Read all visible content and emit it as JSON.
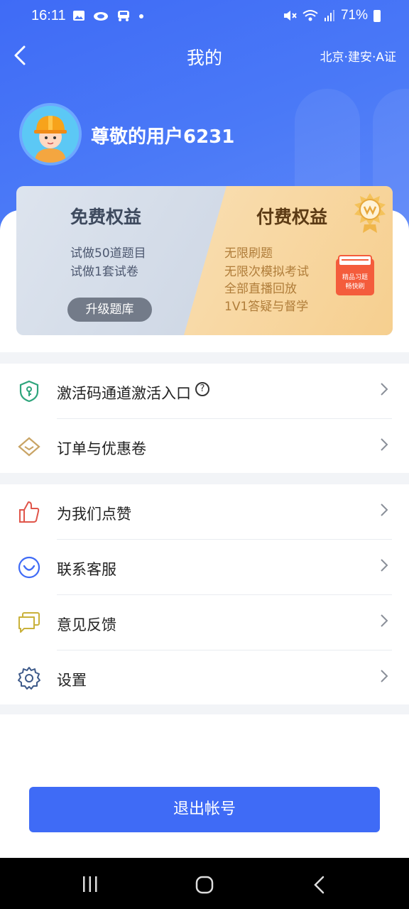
{
  "status_bar": {
    "time": "16:11",
    "left_icons": [
      "image-icon",
      "cloud-icon",
      "car-icon",
      "dot"
    ],
    "battery": "71%"
  },
  "navbar": {
    "title": "我的",
    "region": "北京·建安·A证"
  },
  "profile": {
    "username": "尊敬的用户6231"
  },
  "benefits": {
    "free": {
      "title": "免费权益",
      "items": [
        "试做50道题目",
        "试做1套试卷"
      ],
      "button": "升级题库"
    },
    "paid": {
      "title": "付费权益",
      "items": [
        "无限刷题",
        "无限次模拟考试",
        "全部直播回放",
        "1V1答疑与督学"
      ],
      "badge_text": [
        "精品习题",
        "畅快刷"
      ]
    }
  },
  "menu_group_1": [
    {
      "label": "激活码通道激活入口",
      "icon": "shield-key-icon",
      "help": "?"
    },
    {
      "label": "订单与优惠卷",
      "icon": "coupon-icon"
    }
  ],
  "menu_group_2": [
    {
      "label": "为我们点赞",
      "icon": "thumbs-up-icon"
    },
    {
      "label": "联系客服",
      "icon": "customer-service-icon"
    },
    {
      "label": "意见反馈",
      "icon": "feedback-icon"
    },
    {
      "label": "设置",
      "icon": "gear-icon"
    }
  ],
  "logout": {
    "label": "退出帐号"
  },
  "colors": {
    "primary": "#3f6bf6",
    "free_card": "#c5cfdf",
    "paid_card": "#f6cf8f",
    "page_bg": "#f2f4f7"
  }
}
